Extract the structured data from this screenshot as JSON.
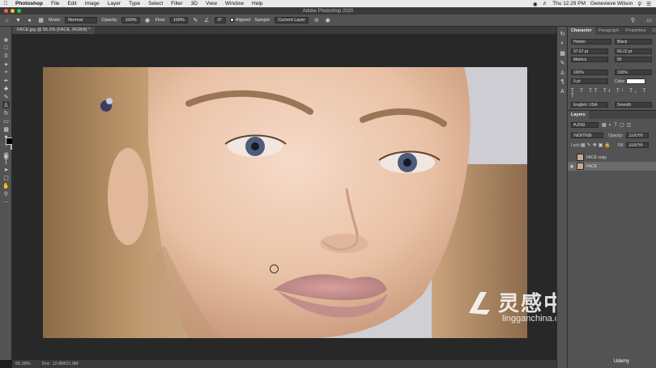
{
  "menubar": {
    "app": "Photoshop",
    "items": [
      "File",
      "Edit",
      "Image",
      "Layer",
      "Type",
      "Select",
      "Filter",
      "3D",
      "View",
      "Window",
      "Help"
    ],
    "clock": "Thu 12:29 PM",
    "user": "Genevieve Wilson"
  },
  "window": {
    "title": "Adobe Photoshop 2020"
  },
  "options": {
    "mode_label": "Mode:",
    "mode_value": "Normal",
    "opacity_label": "Opacity:",
    "opacity_value": "100%",
    "flow_label": "Flow:",
    "flow_value": "100%",
    "angle_value": "0°",
    "aligned_label": "Aligned",
    "sample_label": "Sample:",
    "sample_value": "Current Layer"
  },
  "document": {
    "tab": "FACE.jpg @ 55.3% (FACE, RGB/8) *"
  },
  "status": {
    "zoom": "55.28%",
    "doc": "Doc: 12.8M/21.9M"
  },
  "character_panel": {
    "tabs": [
      "Character",
      "Paragraph",
      "Properties",
      "Color"
    ],
    "font_family": "Heebo",
    "font_style": "Black",
    "size": "37.67 pt",
    "leading": "60.22 pt",
    "kerning": "Metrics",
    "tracking": "80",
    "vscale": "100%",
    "hscale": "100%",
    "baseline": "0 pt",
    "color_label": "Color:",
    "language": "English: USA",
    "antialias": "Smooth"
  },
  "layers_panel": {
    "title": "Layers",
    "filter": "Kind",
    "blend_mode": "Normal",
    "opacity_label": "Opacity:",
    "opacity_value": "100%",
    "lock_label": "Lock:",
    "fill_label": "Fill:",
    "fill_value": "100%",
    "layers": [
      {
        "name": "FACE copy",
        "visible": false,
        "selected": false
      },
      {
        "name": "FACE",
        "visible": true,
        "selected": true
      }
    ]
  },
  "watermark": {
    "cn": "灵感中国",
    "en": "lingganchina.com",
    "udemy": "Udemy"
  },
  "colors": {
    "foreground": "#000000",
    "background": "#5dba7d",
    "ui_dark": "#535353"
  }
}
